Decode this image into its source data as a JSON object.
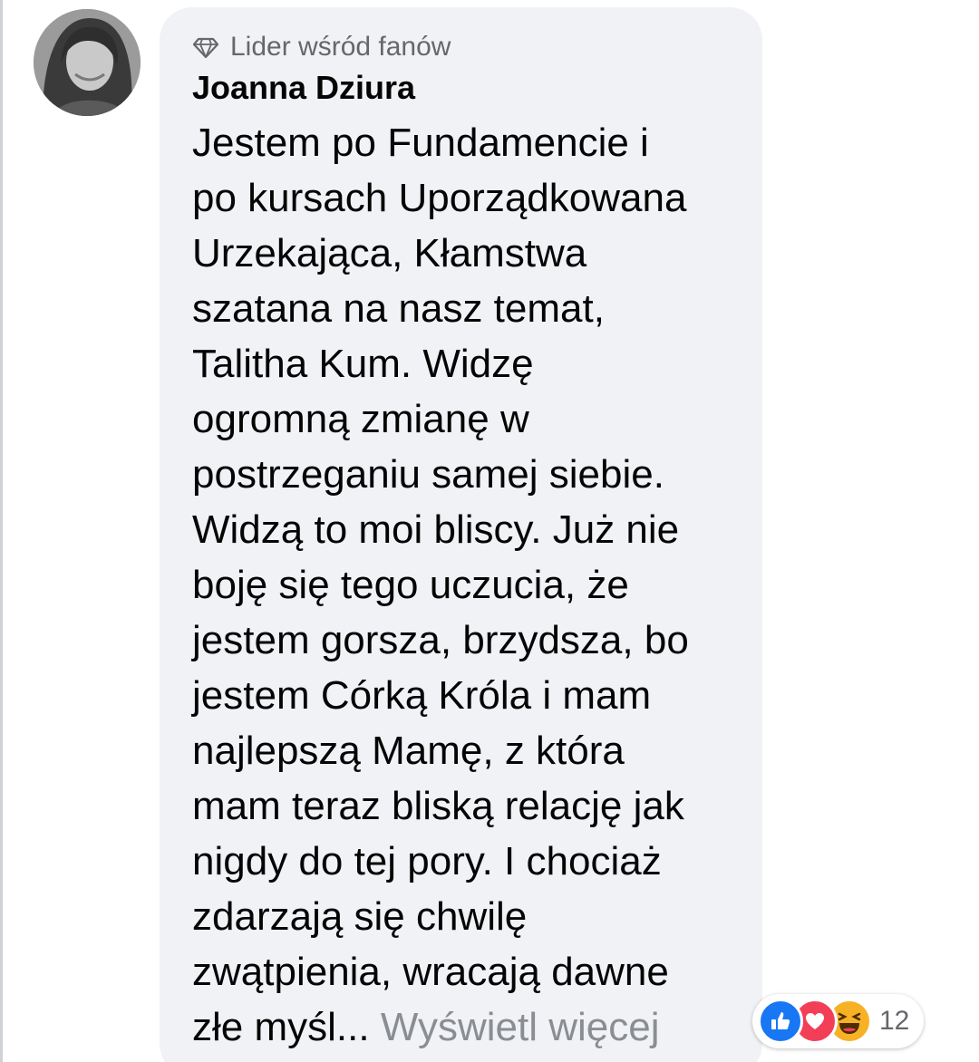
{
  "comment": {
    "badge_label": "Lider wśród fanów",
    "author_name": "Joanna Dziura",
    "body_lines": [
      "Jestem po Fundamencie i",
      "po kursach Uporządkowana",
      "Urzekająca, Kłamstwa",
      "szatana na nasz temat,",
      "Talitha Kum. Widzę",
      "ogromną zmianę w",
      "postrzeganiu samej siebie.",
      "Widzą to moi bliscy. Już nie",
      "boję się tego uczucia, że",
      "jestem gorsza, brzydsza, bo",
      "jestem Córką Króla i mam",
      "najlepszą Mamę, z która",
      "mam teraz bliską relację jak",
      "nigdy do tej pory. I chociaż",
      "zdarzają się chwilę",
      "zwątpienia, wracają dawne"
    ],
    "last_line_text": "złe myśl...",
    "see_more_label": "Wyświetl więcej"
  },
  "reactions": {
    "icons": [
      "like-icon",
      "love-icon",
      "haha-icon"
    ],
    "count": "12"
  },
  "colors": {
    "bubble": "#f0f2f5",
    "secondary_text": "#65676b",
    "see_more_text": "#8a8d91",
    "like": "#1877f2",
    "love": "#f33e58",
    "haha": "#f7b125"
  }
}
